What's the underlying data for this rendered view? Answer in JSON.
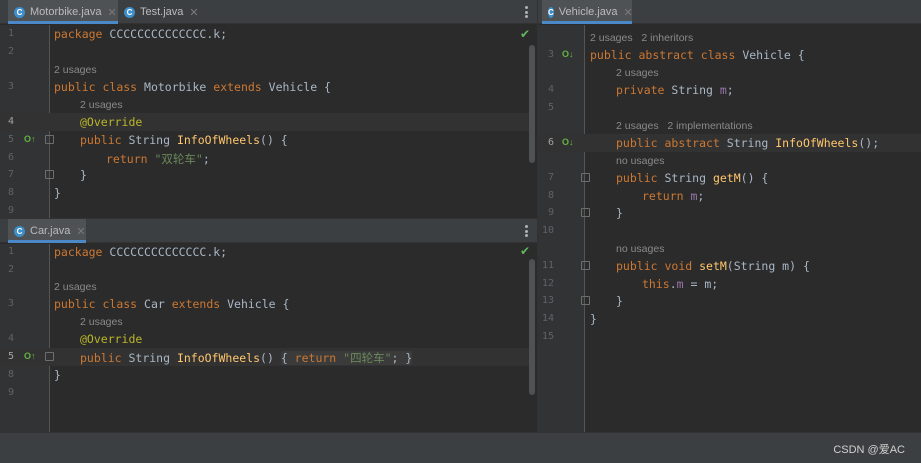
{
  "top_left_tabs": [
    {
      "label": "Motorbike.java",
      "icon": "C"
    },
    {
      "label": "Test.java",
      "icon": "C"
    }
  ],
  "bottom_left_tabs": [
    {
      "label": "Car.java",
      "icon": "C"
    }
  ],
  "right_tabs": [
    {
      "label": "Vehicle.java",
      "icon": "C"
    }
  ],
  "motorbike": {
    "ln": [
      "1",
      "2",
      "3",
      "4",
      "5",
      "6",
      "7",
      "8",
      "9"
    ],
    "package_kw": "package",
    "package_name": " CCCCCCCCCCCCCC.k;",
    "usages_class": "2 usages",
    "class_line": {
      "k1": "public",
      "k2": " class",
      "name": " Motorbike",
      "k3": " extends",
      "parent": " Vehicle {"
    },
    "usages_method": "2 usages",
    "override": "@Override",
    "method_line": {
      "k1": "public",
      "t": " String ",
      "name": "InfoOfWheels",
      "rest": "() {"
    },
    "return_line": {
      "k": "return ",
      "str": "\"双轮车\"",
      "semi": ";"
    },
    "close_method": "}",
    "close_class": "}"
  },
  "car": {
    "ln": [
      "1",
      "2",
      "3",
      "4",
      "5",
      "8",
      "9"
    ],
    "package_kw": "package",
    "package_name": " CCCCCCCCCCCCCC.k;",
    "usages_class": "2 usages",
    "class_line": {
      "k1": "public",
      "k2": " class",
      "name": " Car",
      "k3": " extends",
      "parent": " Vehicle {"
    },
    "usages_method": "2 usages",
    "override": "@Override",
    "method_line": {
      "k1": "public",
      "t": " String ",
      "name": "InfoOfWheels",
      "rest": "() ",
      "brace_open": "{ ",
      "ret": "return ",
      "str": "\"四轮车\"",
      "semi": ";",
      "brace_close": " }"
    },
    "close_class": "}"
  },
  "vehicle": {
    "ln": [
      "3",
      "4",
      "5",
      "6",
      "7",
      "8",
      "9",
      "10",
      "11",
      "12",
      "13",
      "14",
      "15"
    ],
    "hint_top": "2 usages   2 inheritors",
    "class_line": {
      "k1": "public",
      "k2": " abstract",
      "k3": " class",
      "name": " Vehicle {"
    },
    "usages_field": "2 usages",
    "field_line": {
      "k1": "private",
      "t": " String ",
      "name": "m",
      "semi": ";"
    },
    "hint_abstract": "2 usages   2 implementations",
    "abstract_line": {
      "k1": "public",
      "k2": " abstract",
      "t": " String ",
      "name": "InfoOfWheels",
      "rest": "();"
    },
    "no_usages_1": "no usages",
    "getm_line": {
      "k1": "public",
      "t": " String ",
      "name": "getM",
      "rest": "() {"
    },
    "return_line": {
      "k": "return ",
      "name": "m",
      "semi": ";"
    },
    "close1": "}",
    "no_usages_2": "no usages",
    "setm_line": {
      "k1": "public",
      "k2": " void ",
      "name": "setM",
      "rest": "(String m) {"
    },
    "assign_line": {
      "k": "this",
      "dot": ".",
      "name": "m",
      "rest": " = m;"
    },
    "close2": "}",
    "close_class": "}"
  },
  "watermark": "CSDN @爱AC",
  "colors": {
    "keyword": "#cc7832",
    "function": "#ffc66d",
    "string": "#6a8759",
    "annotation": "#bbb529",
    "field": "#9876aa",
    "accent": "#4a88c7"
  }
}
